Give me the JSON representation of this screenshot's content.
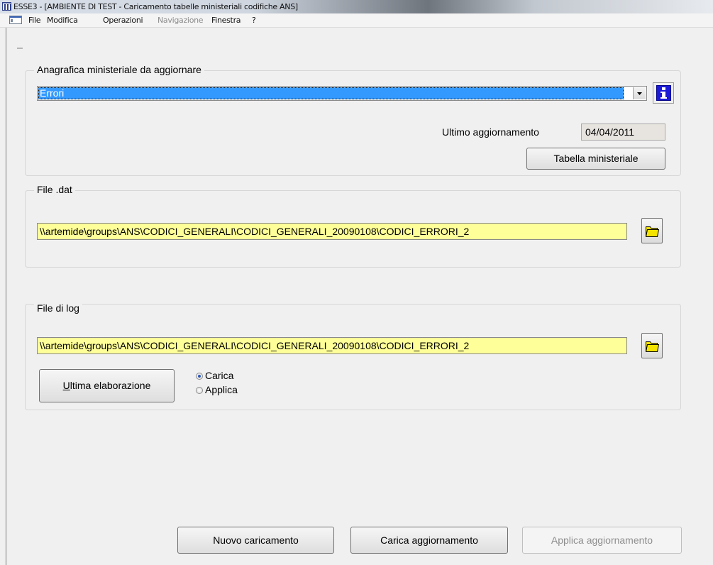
{
  "window": {
    "title": "ESSE3 - [AMBIENTE DI TEST - Caricamento tabelle ministeriali codifiche ANS]"
  },
  "menu": {
    "items": [
      {
        "label": "File",
        "enabled": true
      },
      {
        "label": "Modifica",
        "enabled": true
      },
      {
        "label": "Operazioni",
        "enabled": true
      },
      {
        "label": "Navigazione",
        "enabled": false
      },
      {
        "label": "Finestra",
        "enabled": true
      },
      {
        "label": "?",
        "enabled": true
      }
    ]
  },
  "anagrafica": {
    "legend": "Anagrafica ministeriale da aggiornare",
    "selected": "Errori",
    "ultimo_label": "Ultimo aggiornamento",
    "ultimo_value": "04/04/2011",
    "tabella_button": "Tabella ministeriale"
  },
  "file_dat": {
    "legend": "File .dat",
    "path": "\\\\artemide\\groups\\ANS\\CODICI_GENERALI\\CODICI_GENERALI_20090108\\CODICI_ERRORI_2"
  },
  "file_log": {
    "legend": "File di log",
    "path": "\\\\artemide\\groups\\ANS\\CODICI_GENERALI\\CODICI_GENERALI_20090108\\CODICI_ERRORI_2",
    "ultima_button_first": "U",
    "ultima_button_rest": "ltima elaborazione",
    "radio_options": [
      {
        "label": "Carica",
        "checked": true
      },
      {
        "label": "Applica",
        "checked": false
      }
    ]
  },
  "footer": {
    "nuovo_button": "Nuovo caricamento",
    "carica_button": "Carica aggiornamento",
    "applica_button": "Applica aggiornamento"
  },
  "colors": {
    "path_field_bg": "#ffff99",
    "selection_bg": "#3399ff",
    "info_icon": "#1a1ad8",
    "folder_icon": "#f5e400"
  }
}
